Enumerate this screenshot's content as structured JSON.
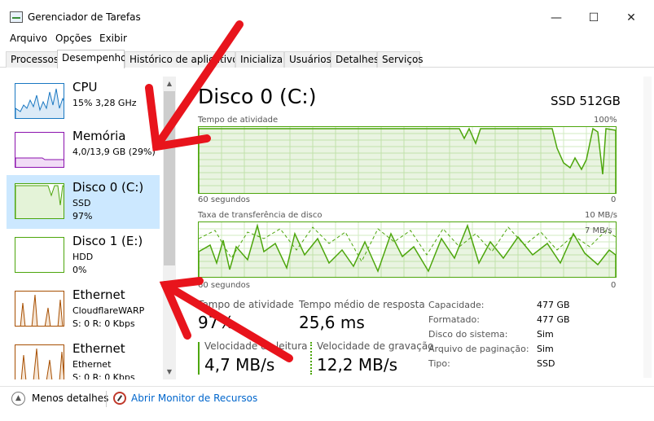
{
  "window": {
    "title": "Gerenciador de Tarefas",
    "minimize": "—",
    "maximize": "☐",
    "close": "✕"
  },
  "menu": [
    "Arquivo",
    "Opções",
    "Exibir"
  ],
  "tabs": [
    "Processos",
    "Desempenho",
    "Histórico de aplicativos",
    "Inicializar",
    "Usuários",
    "Detalhes",
    "Serviços"
  ],
  "active_tab": "Desempenho",
  "sidebar": {
    "items": [
      {
        "name": "CPU",
        "line1": "15% 3,28 GHz",
        "line2": "",
        "color": "#1a78c2"
      },
      {
        "name": "Memória",
        "line1": "4,0/13,9 GB (29%)",
        "line2": "",
        "color": "#8b12ae"
      },
      {
        "name": "Disco 0 (C:)",
        "line1": "SSD",
        "line2": "97%",
        "color": "#4da60c"
      },
      {
        "name": "Disco 1 (E:)",
        "line1": "HDD",
        "line2": "0%",
        "color": "#4da60c"
      },
      {
        "name": "Ethernet",
        "line1": "CloudflareWARP",
        "line2": "S: 0 R: 0 Kbps",
        "color": "#a74f01"
      },
      {
        "name": "Ethernet",
        "line1": "Ethernet",
        "line2": "S: 0 R: 0 Kbps",
        "color": "#a74f01"
      }
    ]
  },
  "main": {
    "title": "Disco 0 (C:)",
    "subtitle": "SSD 512GB",
    "graph1": {
      "label": "Tempo de atividade",
      "max": "100%",
      "time": "60 segundos",
      "min": "0"
    },
    "graph2": {
      "label": "Taxa de transferência de disco",
      "max": "10 MB/s",
      "inner": "7 MB/s",
      "time": "60 segundos",
      "min": "0"
    },
    "stats": {
      "active_label": "Tempo de atividade",
      "active_value": "97%",
      "response_label": "Tempo médio de resposta",
      "response_value": "25,6 ms",
      "read_label": "Velocidade de leitura",
      "read_value": "4,7 MB/s",
      "write_label": "Velocidade de gravação",
      "write_value": "12,2 MB/s"
    },
    "properties": [
      {
        "label": "Capacidade:",
        "value": "477 GB"
      },
      {
        "label": "Formatado:",
        "value": "477 GB"
      },
      {
        "label": "Disco do sistema:",
        "value": "Sim"
      },
      {
        "label": "Arquivo de paginação:",
        "value": "Sim"
      },
      {
        "label": "Tipo:",
        "value": "SSD"
      }
    ]
  },
  "footer": {
    "less": "Menos detalhes",
    "monitor": "Abrir Monitor de Recursos"
  },
  "colors": {
    "disk": "#4da60c",
    "selection": "#cce8ff",
    "annotation": "#e8141c",
    "link": "#0066cc"
  },
  "icons": [
    "app-icon",
    "chevron-up-icon",
    "resource-monitor-icon"
  ]
}
